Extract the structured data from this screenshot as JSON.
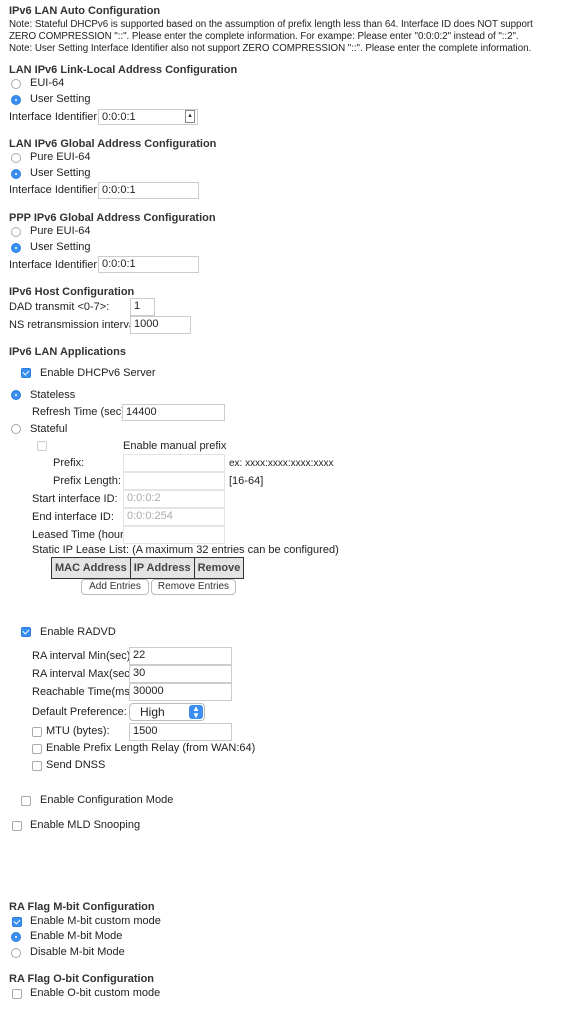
{
  "auto": {
    "title": "IPv6 LAN Auto Configuration",
    "notes": [
      "Note: Stateful DHCPv6 is supported based on the assumption of prefix length less than 64. Interface ID does NOT support",
      "ZERO COMPRESSION \"::\". Please enter the complete information. For exampe: Please enter \"0:0:0:2\" instead of \"::2\".",
      "Note: User Setting Interface Identifier also not support ZERO COMPRESSION \"::\". Please enter the complete information."
    ]
  },
  "linklocal": {
    "title": "LAN IPv6 Link-Local Address Configuration",
    "opt1": "EUI-64",
    "opt2": "User Setting",
    "selected": "User Setting",
    "iid_label": "Interface Identifier:",
    "iid_value": "0:0:0:1"
  },
  "global": {
    "title": "LAN IPv6 Global Address Configuration",
    "opt1": "Pure EUI-64",
    "opt2": "User Setting",
    "selected": "User Setting",
    "iid_label": "Interface Identifier:",
    "iid_value": "0:0:0:1"
  },
  "ppp": {
    "title": "PPP IPv6 Global Address Configuration",
    "opt1": "Pure EUI-64",
    "opt2": "User Setting",
    "selected": "User Setting",
    "iid_label": "Interface Identifier:",
    "iid_value": "0:0:0:1"
  },
  "host": {
    "title": "IPv6 Host Configuration",
    "dad_label": "DAD transmit <0-7>:",
    "dad_value": "1",
    "ns_label": "NS retransmission interval:",
    "ns_value": "1000"
  },
  "apps": {
    "title": "IPv6 LAN Applications",
    "dhcp_label": "Enable DHCPv6 Server",
    "dhcp_checked": true,
    "stateless": "Stateless",
    "refresh_label": "Refresh Time (sec):",
    "refresh_value": "14400",
    "stateful": "Stateful",
    "manual_prefix": "Enable manual prefix",
    "prefix_label": "Prefix:",
    "prefix_hint": "ex: xxxx:xxxx:xxxx:xxxx",
    "prefix_len_label": "Prefix Length:",
    "prefix_len_hint": "[16-64]",
    "start_label": "Start interface ID:",
    "start_value": "0:0:0:2",
    "end_label": "End interface ID:",
    "end_value": "0:0:0:254",
    "leased_label": "Leased Time (hour):",
    "static_label": "Static IP Lease List: (A maximum 32 entries can be configured)",
    "columns": [
      "MAC Address",
      "IP Address",
      "Remove"
    ],
    "add_btn": "Add Entries",
    "remove_btn": "Remove Entries"
  },
  "radvd": {
    "enable_label": "Enable RADVD",
    "checked": true,
    "min_label": "RA interval Min(sec):",
    "min_value": "22",
    "max_label": "RA interval Max(sec):",
    "max_value": "30",
    "reach_label": "Reachable Time(ms):",
    "reach_value": "30000",
    "pref_label": "Default Preference:",
    "pref_value": "High",
    "mtu_label": "MTU (bytes):",
    "mtu_value": "1500",
    "relay_label": "Enable Prefix Length Relay (from WAN:64)",
    "dnss_label": "Send DNSS"
  },
  "config_mode": "Enable Configuration Mode",
  "mld": "Enable MLD Snooping",
  "mflag": {
    "title": "RA Flag M-bit Configuration",
    "custom": "Enable M-bit custom mode",
    "enable": "Enable M-bit Mode",
    "disable": "Disable M-bit Mode"
  },
  "oflag": {
    "title": "RA Flag O-bit Configuration",
    "custom": "Enable O-bit custom mode"
  },
  "colors": {
    "accent": "#3b8ff0"
  }
}
